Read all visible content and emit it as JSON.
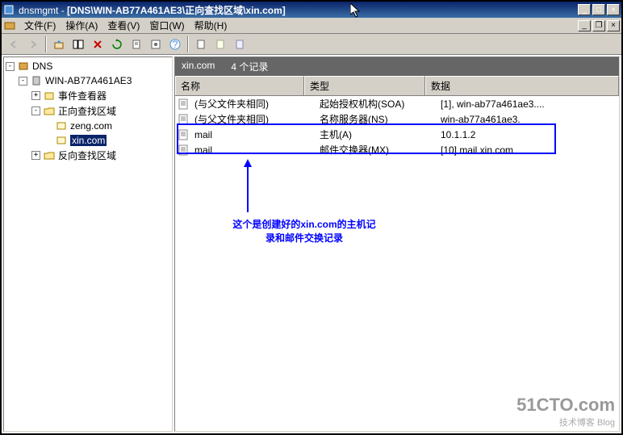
{
  "window": {
    "app": "dnsmgmt",
    "path": "[DNS\\WIN-AB77A461AE3\\正向查找区域\\xin.com]",
    "minimize": "_",
    "maximize": "□",
    "close": "×"
  },
  "menu": {
    "file": "文件(F)",
    "action": "操作(A)",
    "view": "查看(V)",
    "window": "窗口(W)",
    "help": "帮助(H)"
  },
  "tree": {
    "root": "DNS",
    "server": "WIN-AB77A461AE3",
    "event": "事件查看器",
    "fwd": "正向查找区域",
    "z1": "zeng.com",
    "z2": "xin.com",
    "rev": "反向查找区域"
  },
  "zone_header": {
    "name": "xin.com",
    "count": "4 个记录"
  },
  "columns": {
    "name": "名称",
    "type": "类型",
    "data": "数据"
  },
  "records": [
    {
      "name": "(与父文件夹相同)",
      "type": "起始授权机构(SOA)",
      "data": "[1], win-ab77a461ae3...."
    },
    {
      "name": "(与父文件夹相同)",
      "type": "名称服务器(NS)",
      "data": "win-ab77a461ae3."
    },
    {
      "name": "mail",
      "type": "主机(A)",
      "data": "10.1.1.2"
    },
    {
      "name": "mail",
      "type": "邮件交换器(MX)",
      "data": "[10]  mail.xin.com"
    }
  ],
  "annotation": {
    "line1": "这个是创建好的xin.com的主机记",
    "line2": "录和邮件交换记录"
  },
  "watermark": {
    "big": "51CTO.com",
    "small": "技术博客  Blog"
  }
}
